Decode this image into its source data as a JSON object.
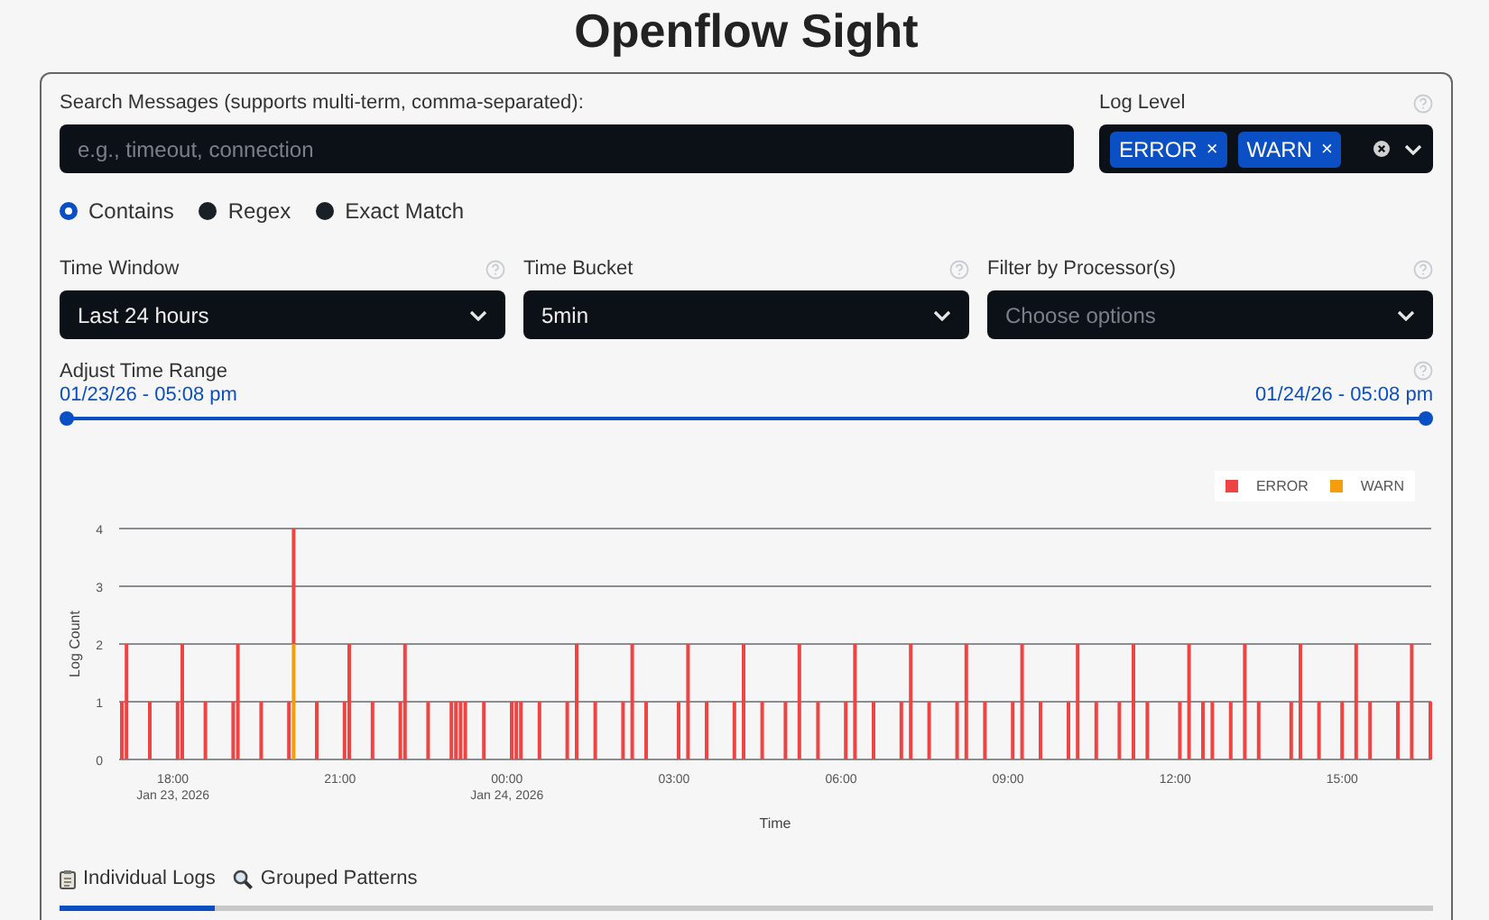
{
  "title": "Openflow Sight",
  "search": {
    "label": "Search Messages (supports multi-term, comma-separated):",
    "placeholder": "e.g., timeout, connection"
  },
  "log_level": {
    "label": "Log Level",
    "chips": [
      {
        "label": "ERROR",
        "remove": "×"
      },
      {
        "label": "WARN",
        "remove": "×"
      }
    ]
  },
  "match_modes": [
    {
      "label": "Contains",
      "selected": true
    },
    {
      "label": "Regex",
      "selected": false
    },
    {
      "label": "Exact Match",
      "selected": false
    }
  ],
  "filters": [
    {
      "label": "Time Window",
      "value": "Last 24 hours"
    },
    {
      "label": "Time Bucket",
      "value": "5min"
    },
    {
      "label": "Filter by Processor(s)",
      "placeholder": "Choose options"
    }
  ],
  "time_range": {
    "label": "Adjust Time Range",
    "start": "01/23/26 - 05:08 pm",
    "end": "01/24/26 - 05:08 pm",
    "handles": [
      {
        "level": 0
      },
      {
        "level": 1
      }
    ]
  },
  "chart": {
    "chart_data": {
      "type": "bar",
      "stacked": true,
      "grid": true,
      "legend": "top-right",
      "xlabel": "Time",
      "ylabel": "Log Count",
      "xlim": [
        "2026-01-23T17:02",
        "2026-01-24T16:36"
      ],
      "ylim": [
        0,
        4
      ],
      "yticks": [
        0,
        1,
        2,
        3,
        4
      ],
      "xticks": [
        {
          "value": "2026-01-23T18:00",
          "label": "18:00\nJan 23, 2026"
        },
        {
          "value": "2026-01-23T21:00",
          "label": "21:00"
        },
        {
          "value": "2026-01-24T00:00",
          "label": "00:00\nJan 24, 2026"
        },
        {
          "value": "2026-01-24T03:00",
          "label": "03:00"
        },
        {
          "value": "2026-01-24T06:00",
          "label": "06:00"
        },
        {
          "value": "2026-01-24T09:00",
          "label": "09:00"
        },
        {
          "value": "2026-01-24T12:00",
          "label": "12:00"
        },
        {
          "value": "2026-01-24T15:00",
          "label": "15:00"
        }
      ],
      "x": [
        "2026-01-23T17:05",
        "2026-01-23T17:10",
        "2026-01-23T17:35",
        "2026-01-23T18:05",
        "2026-01-23T18:10",
        "2026-01-23T18:35",
        "2026-01-23T19:05",
        "2026-01-23T19:10",
        "2026-01-23T19:35",
        "2026-01-23T20:05",
        "2026-01-23T20:10",
        "2026-01-23T20:35",
        "2026-01-23T21:05",
        "2026-01-23T21:10",
        "2026-01-23T21:35",
        "2026-01-23T22:05",
        "2026-01-23T22:10",
        "2026-01-23T22:35",
        "2026-01-23T23:00",
        "2026-01-23T23:05",
        "2026-01-23T23:10",
        "2026-01-23T23:15",
        "2026-01-23T23:35",
        "2026-01-24T00:05",
        "2026-01-24T00:10",
        "2026-01-24T00:15",
        "2026-01-24T00:35",
        "2026-01-24T01:05",
        "2026-01-24T01:15",
        "2026-01-24T01:35",
        "2026-01-24T02:05",
        "2026-01-24T02:15",
        "2026-01-24T02:30",
        "2026-01-24T03:05",
        "2026-01-24T03:15",
        "2026-01-24T03:35",
        "2026-01-24T04:05",
        "2026-01-24T04:15",
        "2026-01-24T04:35",
        "2026-01-24T05:00",
        "2026-01-24T05:15",
        "2026-01-24T05:35",
        "2026-01-24T06:05",
        "2026-01-24T06:15",
        "2026-01-24T06:35",
        "2026-01-24T07:05",
        "2026-01-24T07:15",
        "2026-01-24T07:35",
        "2026-01-24T08:05",
        "2026-01-24T08:15",
        "2026-01-24T08:35",
        "2026-01-24T09:05",
        "2026-01-24T09:15",
        "2026-01-24T09:35",
        "2026-01-24T10:05",
        "2026-01-24T10:15",
        "2026-01-24T10:35",
        "2026-01-24T11:00",
        "2026-01-24T11:15",
        "2026-01-24T11:30",
        "2026-01-24T12:05",
        "2026-01-24T12:15",
        "2026-01-24T12:30",
        "2026-01-24T12:40",
        "2026-01-24T13:00",
        "2026-01-24T13:15",
        "2026-01-24T13:30",
        "2026-01-24T14:05",
        "2026-01-24T14:15",
        "2026-01-24T14:35",
        "2026-01-24T15:00",
        "2026-01-24T15:15",
        "2026-01-24T15:30",
        "2026-01-24T16:00",
        "2026-01-24T16:15",
        "2026-01-24T16:35"
      ],
      "series": [
        {
          "name": "ERROR",
          "color": "#ef4444",
          "values": [
            1,
            2,
            1,
            1,
            2,
            1,
            1,
            2,
            1,
            1,
            2,
            1,
            1,
            2,
            1,
            1,
            2,
            1,
            1,
            1,
            1,
            1,
            1,
            1,
            1,
            1,
            1,
            1,
            2,
            1,
            1,
            2,
            1,
            1,
            2,
            1,
            1,
            2,
            1,
            1,
            2,
            1,
            1,
            2,
            1,
            1,
            2,
            1,
            1,
            2,
            1,
            1,
            2,
            1,
            1,
            2,
            1,
            1,
            2,
            1,
            1,
            2,
            1,
            1,
            1,
            2,
            1,
            1,
            2,
            1,
            1,
            2,
            1,
            1,
            2,
            1
          ]
        },
        {
          "name": "WARN",
          "color": "#f59e0b",
          "values": [
            null,
            null,
            null,
            null,
            null,
            null,
            null,
            null,
            null,
            null,
            2,
            null,
            null,
            null,
            null,
            null,
            null,
            null,
            null,
            null,
            null,
            null,
            null,
            null,
            null,
            null,
            null,
            null,
            null,
            null,
            null,
            null,
            null,
            null,
            null,
            null,
            null,
            null,
            null,
            null,
            null,
            null,
            null,
            null,
            null,
            null,
            null,
            null,
            null,
            null,
            null,
            null,
            null,
            null,
            null,
            null,
            null,
            null,
            null,
            null,
            null,
            null,
            null,
            null,
            null,
            null,
            null,
            null,
            null,
            null,
            null,
            null,
            null,
            null,
            null,
            null
          ]
        }
      ]
    }
  },
  "tabs": [
    {
      "label": "Individual Logs",
      "selected": true
    },
    {
      "label": "Grouped Patterns",
      "selected": false
    }
  ]
}
